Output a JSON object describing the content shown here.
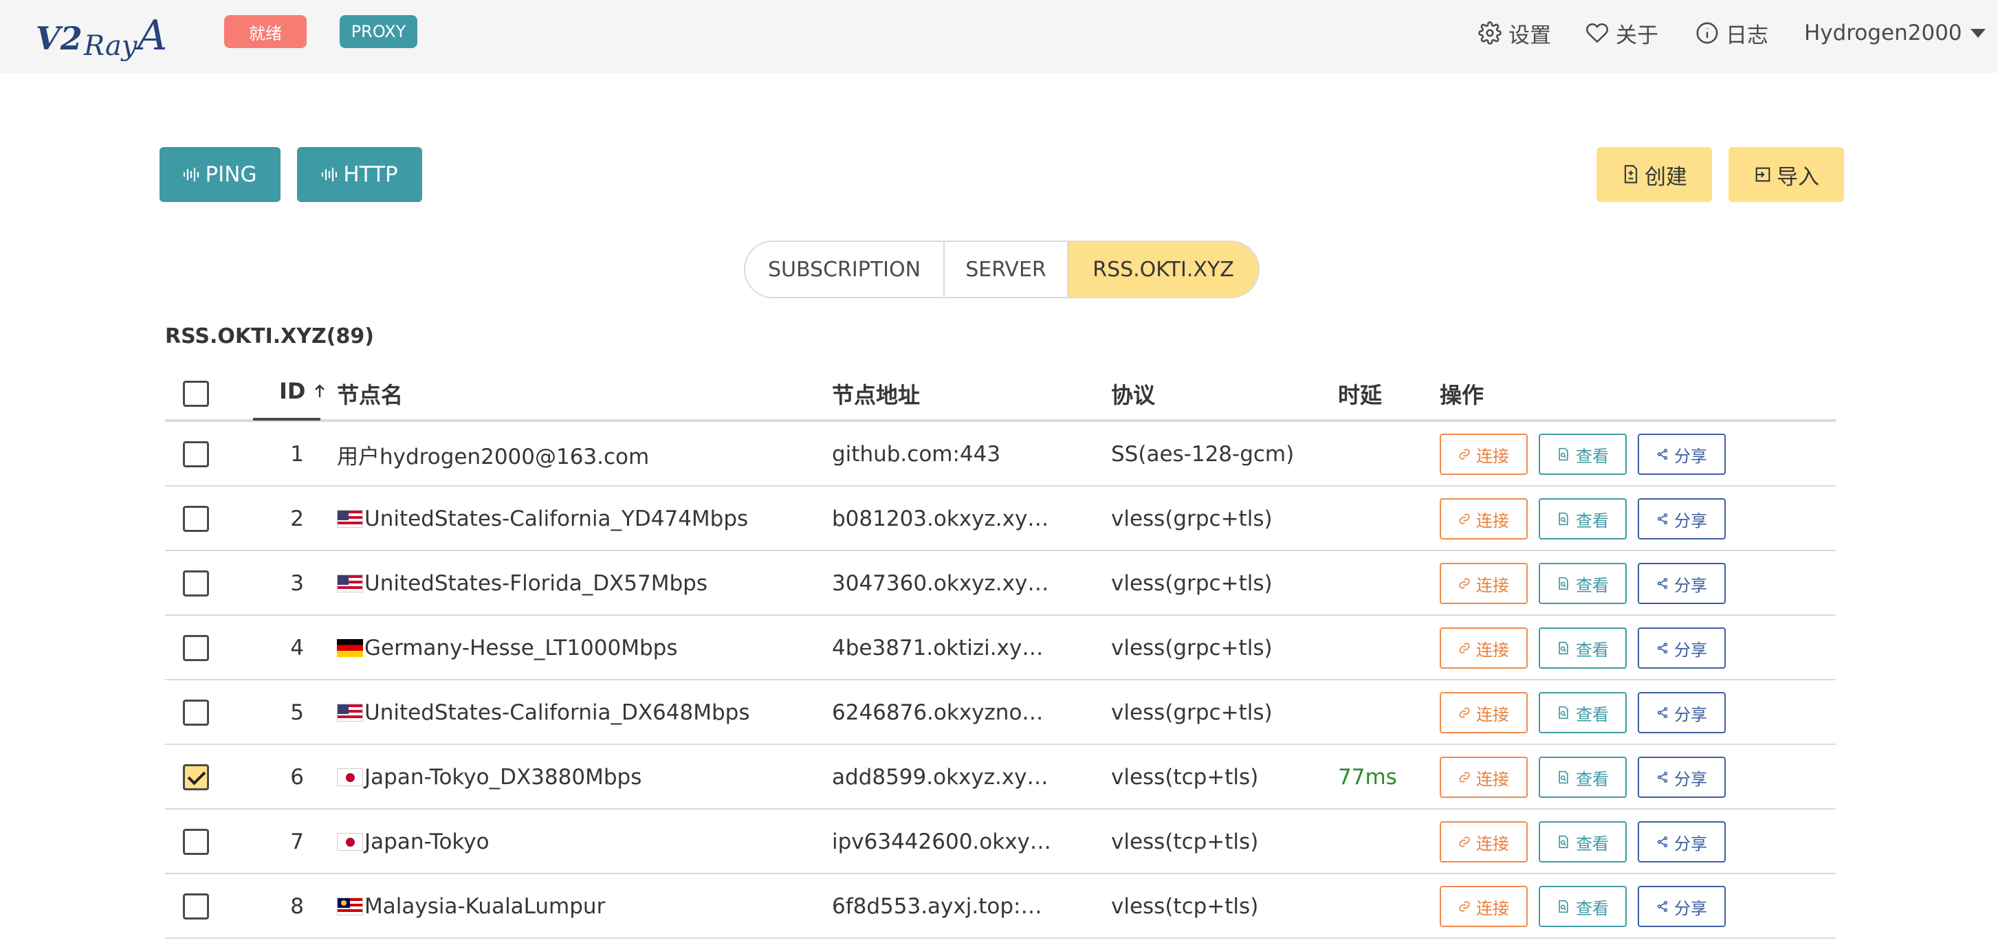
{
  "navbar": {
    "logo_text": "V2RayA",
    "status_tag": "就绪",
    "mode_tag": "PROXY",
    "settings_label": "设置",
    "about_label": "关于",
    "log_label": "日志",
    "user_label": "Hydrogen2000"
  },
  "toolbar": {
    "ping_label": "PING",
    "http_label": "HTTP",
    "create_label": "创建",
    "import_label": "导入"
  },
  "tabs": [
    {
      "label": "SUBSCRIPTION",
      "active": false
    },
    {
      "label": "SERVER",
      "active": false
    },
    {
      "label": "RSS.OKTI.XYZ",
      "active": true
    }
  ],
  "section_title": "RSS.OKTI.XYZ(89)",
  "table": {
    "headers": {
      "id": "ID",
      "name": "节点名",
      "address": "节点地址",
      "protocol": "协议",
      "latency": "时延",
      "ops": "操作"
    },
    "action_labels": {
      "connect": "连接",
      "view": "查看",
      "share": "分享"
    },
    "rows": [
      {
        "id": "1",
        "flag": "",
        "name": "用户hydrogen2000@163.com",
        "address": "github.com:443",
        "protocol": "SS(aes-128-gcm)",
        "latency": "",
        "checked": false
      },
      {
        "id": "2",
        "flag": "us",
        "name": "UnitedStates-California_YD474Mbps",
        "address": "b081203.okxyz.xy…",
        "protocol": "vless(grpc+tls)",
        "latency": "",
        "checked": false
      },
      {
        "id": "3",
        "flag": "us",
        "name": "UnitedStates-Florida_DX57Mbps",
        "address": "3047360.okxyz.xy…",
        "protocol": "vless(grpc+tls)",
        "latency": "",
        "checked": false
      },
      {
        "id": "4",
        "flag": "de",
        "name": "Germany-Hesse_LT1000Mbps",
        "address": "4be3871.oktizi.xy…",
        "protocol": "vless(grpc+tls)",
        "latency": "",
        "checked": false
      },
      {
        "id": "5",
        "flag": "us",
        "name": "UnitedStates-California_DX648Mbps",
        "address": "6246876.okxyzno…",
        "protocol": "vless(grpc+tls)",
        "latency": "",
        "checked": false
      },
      {
        "id": "6",
        "flag": "jp",
        "name": "Japan-Tokyo_DX3880Mbps",
        "address": "add8599.okxyz.xy…",
        "protocol": "vless(tcp+tls)",
        "latency": "77ms",
        "checked": true
      },
      {
        "id": "7",
        "flag": "jp",
        "name": "Japan-Tokyo",
        "address": "ipv63442600.okxy…",
        "protocol": "vless(tcp+tls)",
        "latency": "",
        "checked": false
      },
      {
        "id": "8",
        "flag": "my",
        "name": "Malaysia-KualaLumpur",
        "address": "6f8d553.ayxj.top:…",
        "protocol": "vless(tcp+tls)",
        "latency": "",
        "checked": false
      }
    ]
  },
  "colors": {
    "primary": "#3e9aa5",
    "warning": "#ffe08a",
    "danger_tag": "#f77c73",
    "connect": "#f08c4b",
    "share": "#3d5fa3",
    "latency_good": "#2e8b2e"
  }
}
